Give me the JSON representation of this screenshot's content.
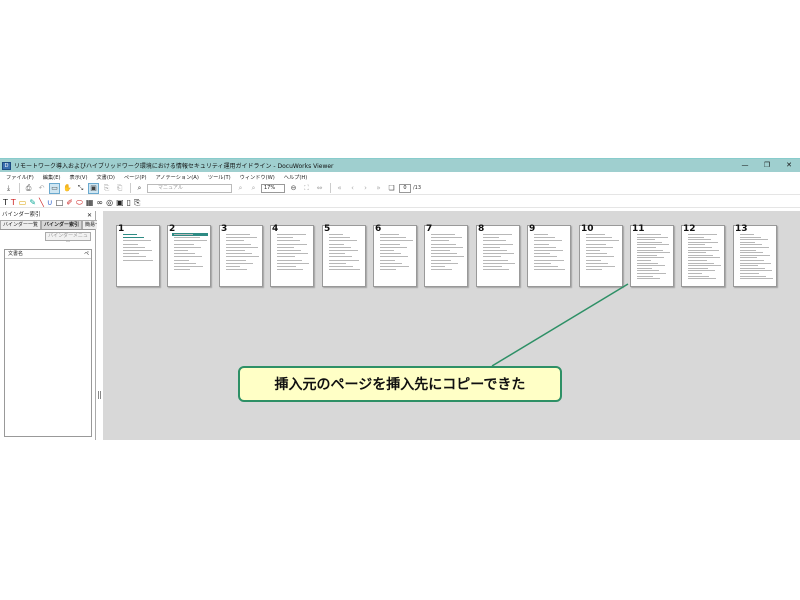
{
  "window": {
    "title": "リモートワーク導入およびハイブリッドワーク環境における情報セキュリティ運用ガイドライン - DocuWorks Viewer",
    "controls": {
      "minimize": "—",
      "maximize": "❐",
      "close": "✕"
    }
  },
  "menu": [
    "ファイル(F)",
    "編集(E)",
    "表示(V)",
    "文書(D)",
    "ページ(P)",
    "アノテーション(A)",
    "ツール(T)",
    "ウィンドウ(W)",
    "ヘルプ(H)"
  ],
  "toolbar": {
    "search_placeholder": "マニュアル",
    "zoom_value": "17%",
    "current_page": "0",
    "total_pages": "/13"
  },
  "sidebar": {
    "title": "バインダー索引",
    "close": "✕",
    "tabs": [
      "バインダー一覧",
      "バインダー索引",
      "簡易一覧"
    ],
    "binder_menu_button": "バインダーメニュー",
    "columns": [
      "文書名",
      "ペ"
    ]
  },
  "pages": [
    "1",
    "2",
    "3",
    "4",
    "5",
    "6",
    "7",
    "8",
    "9",
    "10",
    "11",
    "12",
    "13"
  ],
  "callout": {
    "text": "挿入元のページを挿入先にコピーできた"
  },
  "colors": {
    "titlebar": "#9fcfcf",
    "accent": "#2e9066",
    "callout_bg": "#ffffc6",
    "workspace": "#d8d8d8"
  }
}
